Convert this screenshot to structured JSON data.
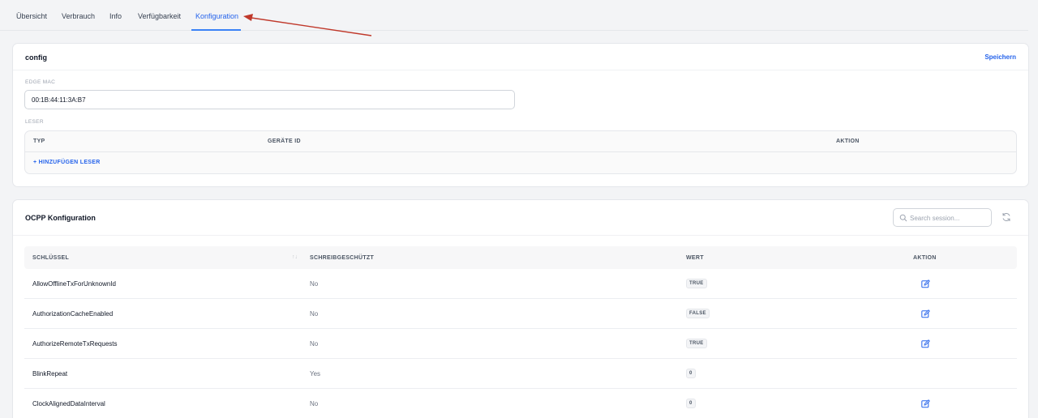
{
  "tabs": [
    {
      "label": "Übersicht"
    },
    {
      "label": "Verbrauch"
    },
    {
      "label": "Info"
    },
    {
      "label": "Verfügbarkeit"
    },
    {
      "label": "Konfiguration",
      "active": true
    }
  ],
  "config_card": {
    "title": "config",
    "save_label": "Speichern",
    "edge_mac_label": "EDGE MAC",
    "edge_mac_value": "00:1B:44:11:3A:B7",
    "leser_label": "LESER",
    "leser_table": {
      "columns": [
        "TYP",
        "GERÄTE ID",
        "AKTION"
      ],
      "add_label": "+ HINZUFÜGEN LESER"
    }
  },
  "ocpp_card": {
    "title": "OCPP Konfiguration",
    "search_placeholder": "Search session...",
    "columns": [
      "SCHLÜSSEL",
      "SCHREIBGESCHÜTZT",
      "WERT",
      "AKTION"
    ],
    "rows": [
      {
        "key": "AllowOfflineTxForUnknownId",
        "readonly": "No",
        "value": "TRUE",
        "editable": true
      },
      {
        "key": "AuthorizationCacheEnabled",
        "readonly": "No",
        "value": "FALSE",
        "editable": true
      },
      {
        "key": "AuthorizeRemoteTxRequests",
        "readonly": "No",
        "value": "TRUE",
        "editable": true
      },
      {
        "key": "BlinkRepeat",
        "readonly": "Yes",
        "value": "0",
        "editable": false
      },
      {
        "key": "ClockAlignedDataInterval",
        "readonly": "No",
        "value": "0",
        "editable": true
      }
    ]
  },
  "colors": {
    "accent": "#2563eb",
    "annotation_arrow": "#c0392b"
  },
  "icons": [
    "search-icon",
    "refresh-icon",
    "edit-icon",
    "sort-icon",
    "annotation-arrow"
  ]
}
